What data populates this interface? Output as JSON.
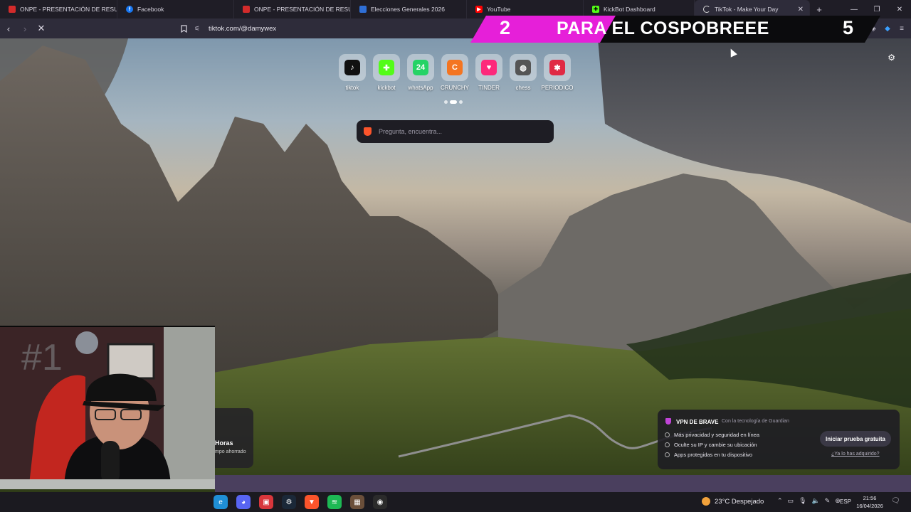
{
  "tabs": [
    {
      "title": "ONPE - PRESENTACIÓN DE RESULTA",
      "color": "#d32b2b"
    },
    {
      "title": "Facebook",
      "color": "#1877f2"
    },
    {
      "title": "ONPE - PRESENTACIÓN DE RESULTA",
      "color": "#d32b2b"
    },
    {
      "title": "Elecciones Generales 2026",
      "color": "#2f6fd6"
    },
    {
      "title": "YouTube",
      "color": "#ff0000"
    },
    {
      "title": "KickBot Dashboard",
      "color": "#53fc18"
    },
    {
      "title": "TikTok - Make Your Day",
      "color": "#111111",
      "active": true
    }
  ],
  "toolbar": {
    "url": "tiktok.com/@damywex"
  },
  "banner": {
    "num_left": "2",
    "text": "PARA EL COSPOBREEE",
    "num_right": "5"
  },
  "shortcuts": [
    {
      "label": "tiktok",
      "icon": "tiktok-icon",
      "color": "#111111",
      "glyph": "♪"
    },
    {
      "label": "kickbot",
      "icon": "kickbot-icon",
      "color": "#53fc18",
      "glyph": "✚"
    },
    {
      "label": "whatsApp",
      "icon": "whatsapp-icon",
      "color": "#25d366",
      "glyph": "24"
    },
    {
      "label": "CRUNCHY",
      "icon": "crunchyroll-icon",
      "color": "#f47521",
      "glyph": "C"
    },
    {
      "label": "TINDER",
      "icon": "tinder-icon",
      "color": "#fd297b",
      "glyph": "♥"
    },
    {
      "label": "chess",
      "icon": "globe-icon",
      "color": "#555555",
      "glyph": "◍"
    },
    {
      "label": "PERIODICO",
      "icon": "periodico-icon",
      "color": "#e02a44",
      "glyph": "✱"
    }
  ],
  "search": {
    "placeholder": "Pregunta, encuentra..."
  },
  "stats": {
    "heading": "Horas",
    "sub": "mpo ahorrado"
  },
  "vpn": {
    "title": "VPN DE BRAVE",
    "tech": "Con la tecnología de  Guardian",
    "features": [
      "Más privacidad y seguridad en línea",
      "Oculte su IP y cambie su ubicación",
      "Apps protegidas en tu dispositivo"
    ],
    "button": "Iniciar prueba gratuita",
    "link": "¿Ya lo has adquirido?"
  },
  "taskbar": {
    "weather": "23°C  Despejado",
    "lang": "ESP",
    "time": "21:56",
    "date": "16/04/2026",
    "apps": [
      {
        "name": "edge-icon",
        "color": "#1f8fd6",
        "glyph": "e"
      },
      {
        "name": "discord-icon",
        "color": "#5865f2",
        "glyph": "◕"
      },
      {
        "name": "app-red-icon",
        "color": "#d8363b",
        "glyph": "▣"
      },
      {
        "name": "steam-icon",
        "color": "#1b2838",
        "glyph": "⚙"
      },
      {
        "name": "brave-icon",
        "color": "#fb542b",
        "glyph": "▼"
      },
      {
        "name": "spotify-icon",
        "color": "#1db954",
        "glyph": "≋"
      },
      {
        "name": "app-active-icon",
        "color": "#6b4f3a",
        "glyph": "▦"
      },
      {
        "name": "obs-icon",
        "color": "#2b2b2b",
        "glyph": "◉"
      }
    ]
  },
  "colors": {
    "accent": "#e61fd9",
    "chrome": "#2e2c3a"
  }
}
